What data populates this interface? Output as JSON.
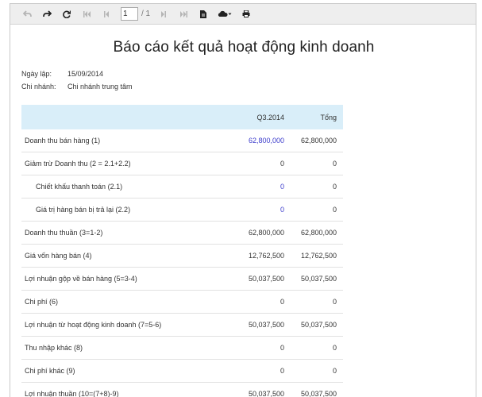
{
  "toolbar": {
    "page_value": "1",
    "page_total": "/ 1"
  },
  "report": {
    "title": "Báo cáo kết quả hoạt động kinh doanh",
    "meta": [
      {
        "label": "Ngày lập:",
        "value": "15/09/2014"
      },
      {
        "label": "Chi nhánh:",
        "value": "Chi nhánh trung tâm"
      }
    ],
    "columns": [
      "",
      "Q3.2014",
      "Tổng"
    ],
    "rows": [
      {
        "label": "Doanh thu bán hàng (1)",
        "q3": "62,800,000",
        "total": "62,800,000"
      },
      {
        "label": "Giảm trừ Doanh thu (2 = 2.1+2.2)",
        "q3": "0",
        "total": "0"
      },
      {
        "label": "Chiết khấu thanh toán (2.1)",
        "q3": "0",
        "total": "0"
      },
      {
        "label": "Giá trị hàng bán bị trả lại (2.2)",
        "q3": "0",
        "total": "0"
      },
      {
        "label": "Doanh thu thuần (3=1-2)",
        "q3": "62,800,000",
        "total": "62,800,000"
      },
      {
        "label": "Giá vốn hàng bán (4)",
        "q3": "12,762,500",
        "total": "12,762,500"
      },
      {
        "label": "Lợi nhuận gộp về bán hàng (5=3-4)",
        "q3": "50,037,500",
        "total": "50,037,500"
      },
      {
        "label": "Chi phí (6)",
        "q3": "0",
        "total": "0"
      },
      {
        "label": "Lợi nhuận từ hoạt động kinh doanh (7=5-6)",
        "q3": "50,037,500",
        "total": "50,037,500"
      },
      {
        "label": "Thu nhập khác (8)",
        "q3": "0",
        "total": "0"
      },
      {
        "label": "Chi phí khác (9)",
        "q3": "0",
        "total": "0"
      },
      {
        "label": "Lợi nhuận thuần (10=(7+8)-9)",
        "q3": "50,037,500",
        "total": "50,037,500"
      }
    ]
  }
}
